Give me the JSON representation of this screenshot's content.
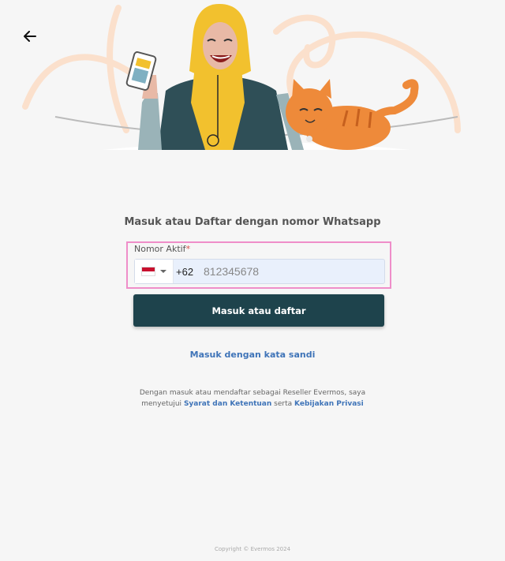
{
  "header": {
    "back_icon": "arrow-left-icon"
  },
  "hero": {
    "illustration": "woman-with-phone-and-cat"
  },
  "form": {
    "title": "Masuk atau Daftar dengan nomor Whatsapp",
    "field_label": "Nomor Aktif",
    "required_mark": "*",
    "country_flag": "indonesia-flag",
    "dial_code": "+62",
    "phone_placeholder": "812345678",
    "submit_label": "Masuk atau daftar"
  },
  "links": {
    "password_login": "Masuk dengan kata sandi"
  },
  "terms": {
    "line1": "Dengan masuk atau mendaftar sebagai Reseller Evermos, saya",
    "prefix": "menyetujui",
    "terms_link": "Syarat dan Ketentuan",
    "connector": "serta",
    "privacy_link": "Kebijakan Privasi"
  },
  "footer": {
    "copyright": "Copyright © Evermos 2024"
  },
  "colors": {
    "primary_button": "#1e434c",
    "link": "#3f74b8",
    "highlight_border": "#ef8ec9",
    "background": "#f6f6f6"
  }
}
